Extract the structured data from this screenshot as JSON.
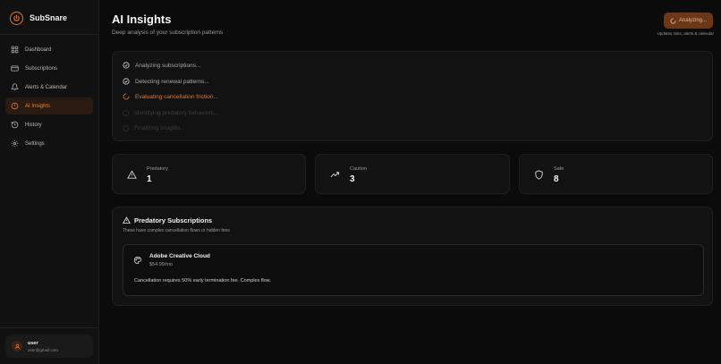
{
  "app": {
    "name": "SubSnare",
    "accent": "#e07a2c"
  },
  "sidebar": {
    "items": [
      {
        "label": "Dashboard",
        "icon": "grid-icon",
        "active": false
      },
      {
        "label": "Subscriptions",
        "icon": "credit-card-icon",
        "active": false
      },
      {
        "label": "Alerts & Calendar",
        "icon": "bell-icon",
        "active": false
      },
      {
        "label": "AI Insights",
        "icon": "alert-circle-icon",
        "active": true
      },
      {
        "label": "History",
        "icon": "history-icon",
        "active": false
      },
      {
        "label": "Settings",
        "icon": "gear-icon",
        "active": false
      }
    ],
    "user": {
      "name": "user",
      "email": "user@gmail.com"
    }
  },
  "header": {
    "title": "AI Insights",
    "subtitle": "Deep analysis of your subscription patterns",
    "button_label": "Analyzing...",
    "note": "Updates risks, alerts & calendar"
  },
  "steps": [
    {
      "label": "Analyzing subscriptions...",
      "status": "done"
    },
    {
      "label": "Detecting renewal patterns...",
      "status": "done"
    },
    {
      "label": "Evaluating cancellation friction...",
      "status": "current"
    },
    {
      "label": "Identifying predatory behaviors...",
      "status": "pending"
    },
    {
      "label": "Finalizing insights...",
      "status": "pending"
    }
  ],
  "stats": [
    {
      "label": "Predatory",
      "value": "1",
      "icon": "warning-triangle-icon"
    },
    {
      "label": "Caution",
      "value": "3",
      "icon": "trending-up-icon"
    },
    {
      "label": "Safe",
      "value": "8",
      "icon": "shield-icon"
    }
  ],
  "predatory": {
    "title": "Predatory Subscriptions",
    "subtitle": "These have complex cancellation flows or hidden fees",
    "items": [
      {
        "name": "Adobe Creative Cloud",
        "price": "$54.99/mo",
        "note": "Cancellation requires 50% early termination fee. Complex flow.",
        "icon": "palette-icon"
      }
    ]
  }
}
